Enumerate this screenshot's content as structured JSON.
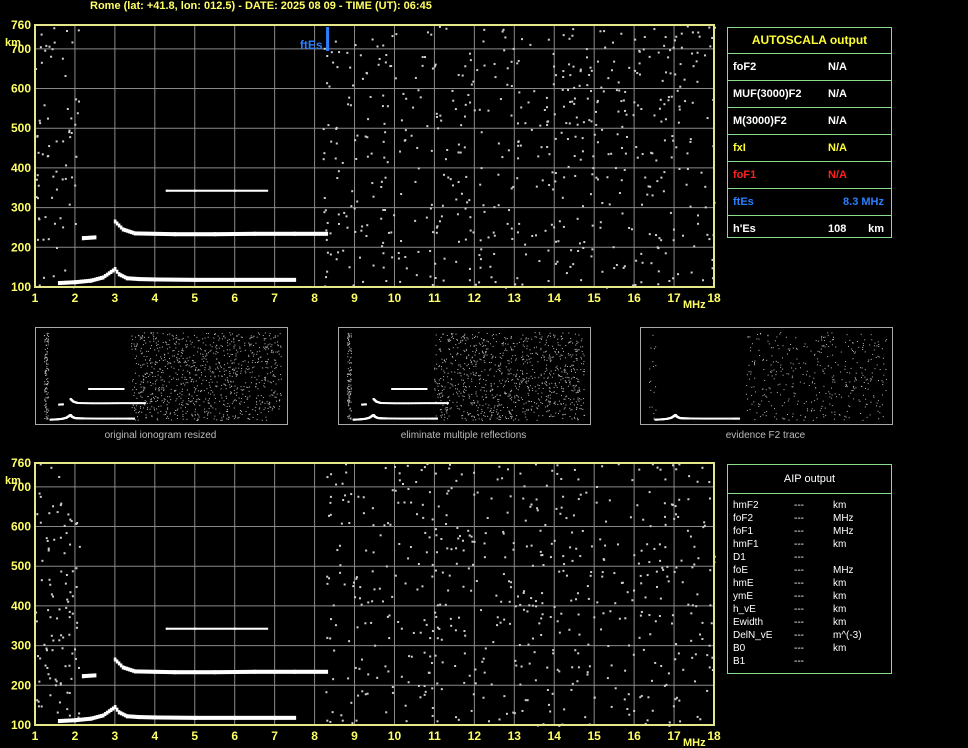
{
  "header": {
    "title": "Rome (lat: +41.8, lon: 012.5) - DATE: 2025 08 09 - TIME (UT): 06:45"
  },
  "colors": {
    "frame": "#e6e68a",
    "grid": "#8a8a8a",
    "axis_text": "#ffff66",
    "trace": "#ffffff",
    "noise": "#cfcfcf",
    "es_marker": "#2a7fff",
    "f1": "#ff2020",
    "box_border": "#88dd88"
  },
  "chart_data": [
    {
      "type": "scatter",
      "title": "",
      "xlabel": "MHz",
      "ylabel": "km",
      "xlim": [
        1,
        18
      ],
      "ylim": [
        100,
        760
      ],
      "xticks": [
        "1",
        "2",
        "3",
        "4",
        "5",
        "6",
        "7",
        "8",
        "9",
        "10",
        "11",
        "12",
        "13",
        "14",
        "15",
        "16",
        "17",
        "18"
      ],
      "yticks": [
        "100",
        "200",
        "300",
        "400",
        "500",
        "600",
        "700",
        "760"
      ],
      "marker_label": "ftEs",
      "marker_freq": 8.3,
      "series": [
        {
          "values": [
            [
              1.6,
              110
            ],
            [
              2.0,
              112
            ],
            [
              2.4,
              116
            ],
            [
              2.7,
              124
            ],
            [
              2.9,
              138
            ],
            [
              3.0,
              145
            ],
            [
              3.1,
              132
            ],
            [
              3.3,
              122
            ],
            [
              3.6,
              120
            ],
            [
              4.0,
              119
            ],
            [
              5.0,
              118
            ],
            [
              6.0,
              118
            ],
            [
              7.0,
              118
            ],
            [
              7.5,
              118
            ]
          ]
        },
        {
          "values": [
            [
              3.0,
              265
            ],
            [
              3.2,
              245
            ],
            [
              3.5,
              235
            ],
            [
              4.5,
              233
            ],
            [
              5.5,
              233
            ],
            [
              6.5,
              234
            ],
            [
              7.5,
              234
            ],
            [
              8.3,
              234
            ]
          ]
        },
        {
          "values": [
            [
              2.2,
              223
            ],
            [
              2.5,
              225
            ]
          ]
        },
        {
          "values": [
            [
              4.3,
              340
            ],
            [
              5.0,
              340
            ],
            [
              6.0,
              340
            ],
            [
              6.8,
              340
            ]
          ]
        }
      ]
    },
    {
      "type": "scatter",
      "title": "",
      "xlabel": "MHz",
      "ylabel": "km",
      "xlim": [
        1,
        18
      ],
      "ylim": [
        100,
        760
      ],
      "xticks": [
        "1",
        "2",
        "3",
        "4",
        "5",
        "6",
        "7",
        "8",
        "9",
        "10",
        "11",
        "12",
        "13",
        "14",
        "15",
        "16",
        "17",
        "18"
      ],
      "yticks": [
        "100",
        "200",
        "300",
        "400",
        "500",
        "600",
        "700",
        "760"
      ],
      "series": [
        {
          "values": [
            [
              1.6,
              110
            ],
            [
              2.0,
              112
            ],
            [
              2.4,
              116
            ],
            [
              2.7,
              124
            ],
            [
              2.9,
              138
            ],
            [
              3.0,
              145
            ],
            [
              3.1,
              132
            ],
            [
              3.3,
              122
            ],
            [
              3.6,
              120
            ],
            [
              4.0,
              119
            ],
            [
              5.0,
              118
            ],
            [
              6.0,
              118
            ],
            [
              7.0,
              118
            ],
            [
              7.5,
              118
            ]
          ]
        },
        {
          "values": [
            [
              3.0,
              265
            ],
            [
              3.2,
              245
            ],
            [
              3.5,
              235
            ],
            [
              4.5,
              233
            ],
            [
              5.5,
              233
            ],
            [
              6.5,
              234
            ],
            [
              7.5,
              234
            ],
            [
              8.3,
              234
            ]
          ]
        },
        {
          "values": [
            [
              2.2,
              223
            ],
            [
              2.5,
              225
            ]
          ]
        },
        {
          "values": [
            [
              4.3,
              340
            ],
            [
              5.0,
              340
            ],
            [
              6.0,
              340
            ],
            [
              6.8,
              340
            ]
          ]
        }
      ]
    }
  ],
  "autoscala": {
    "title": "AUTOSCALA output",
    "rows": [
      {
        "key": "foF2",
        "value": "N/A",
        "unit": "",
        "color": "#ffffff"
      },
      {
        "key": "MUF(3000)F2",
        "value": "N/A",
        "unit": "",
        "color": "#ffffff"
      },
      {
        "key": "M(3000)F2",
        "value": "N/A",
        "unit": "",
        "color": "#ffffff"
      },
      {
        "key": "fxI",
        "value": "N/A",
        "unit": "",
        "color": "#ffff33"
      },
      {
        "key": "foF1",
        "value": "N/A",
        "unit": "",
        "color": "#ff2020"
      },
      {
        "key": "ftEs",
        "value": "8.3 MHz",
        "unit": "",
        "color": "#2a7fff"
      },
      {
        "key": "h'Es",
        "value": "108",
        "unit": "km",
        "color": "#ffffff"
      }
    ]
  },
  "thumbnails": [
    {
      "caption": "original ionogram resized"
    },
    {
      "caption": "eliminate multiple reflections"
    },
    {
      "caption": "evidence F2 trace"
    }
  ],
  "aip": {
    "title": "AIP output",
    "rows": [
      {
        "key": "hmF2",
        "value": "---",
        "unit": "km"
      },
      {
        "key": "foF2",
        "value": "---",
        "unit": "MHz"
      },
      {
        "key": "foF1",
        "value": "---",
        "unit": "MHz"
      },
      {
        "key": "hmF1",
        "value": "---",
        "unit": "km"
      },
      {
        "key": "D1",
        "value": "---",
        "unit": ""
      },
      {
        "key": "foE",
        "value": "---",
        "unit": "MHz"
      },
      {
        "key": "hmE",
        "value": "---",
        "unit": "km"
      },
      {
        "key": "ymE",
        "value": "---",
        "unit": "km"
      },
      {
        "key": "h_vE",
        "value": "---",
        "unit": "km"
      },
      {
        "key": "Ewidth",
        "value": "---",
        "unit": "km"
      },
      {
        "key": "DelN_vE",
        "value": "---",
        "unit": "m^(-3)"
      },
      {
        "key": "B0",
        "value": "---",
        "unit": "km"
      },
      {
        "key": "B1",
        "value": "---",
        "unit": ""
      }
    ]
  }
}
